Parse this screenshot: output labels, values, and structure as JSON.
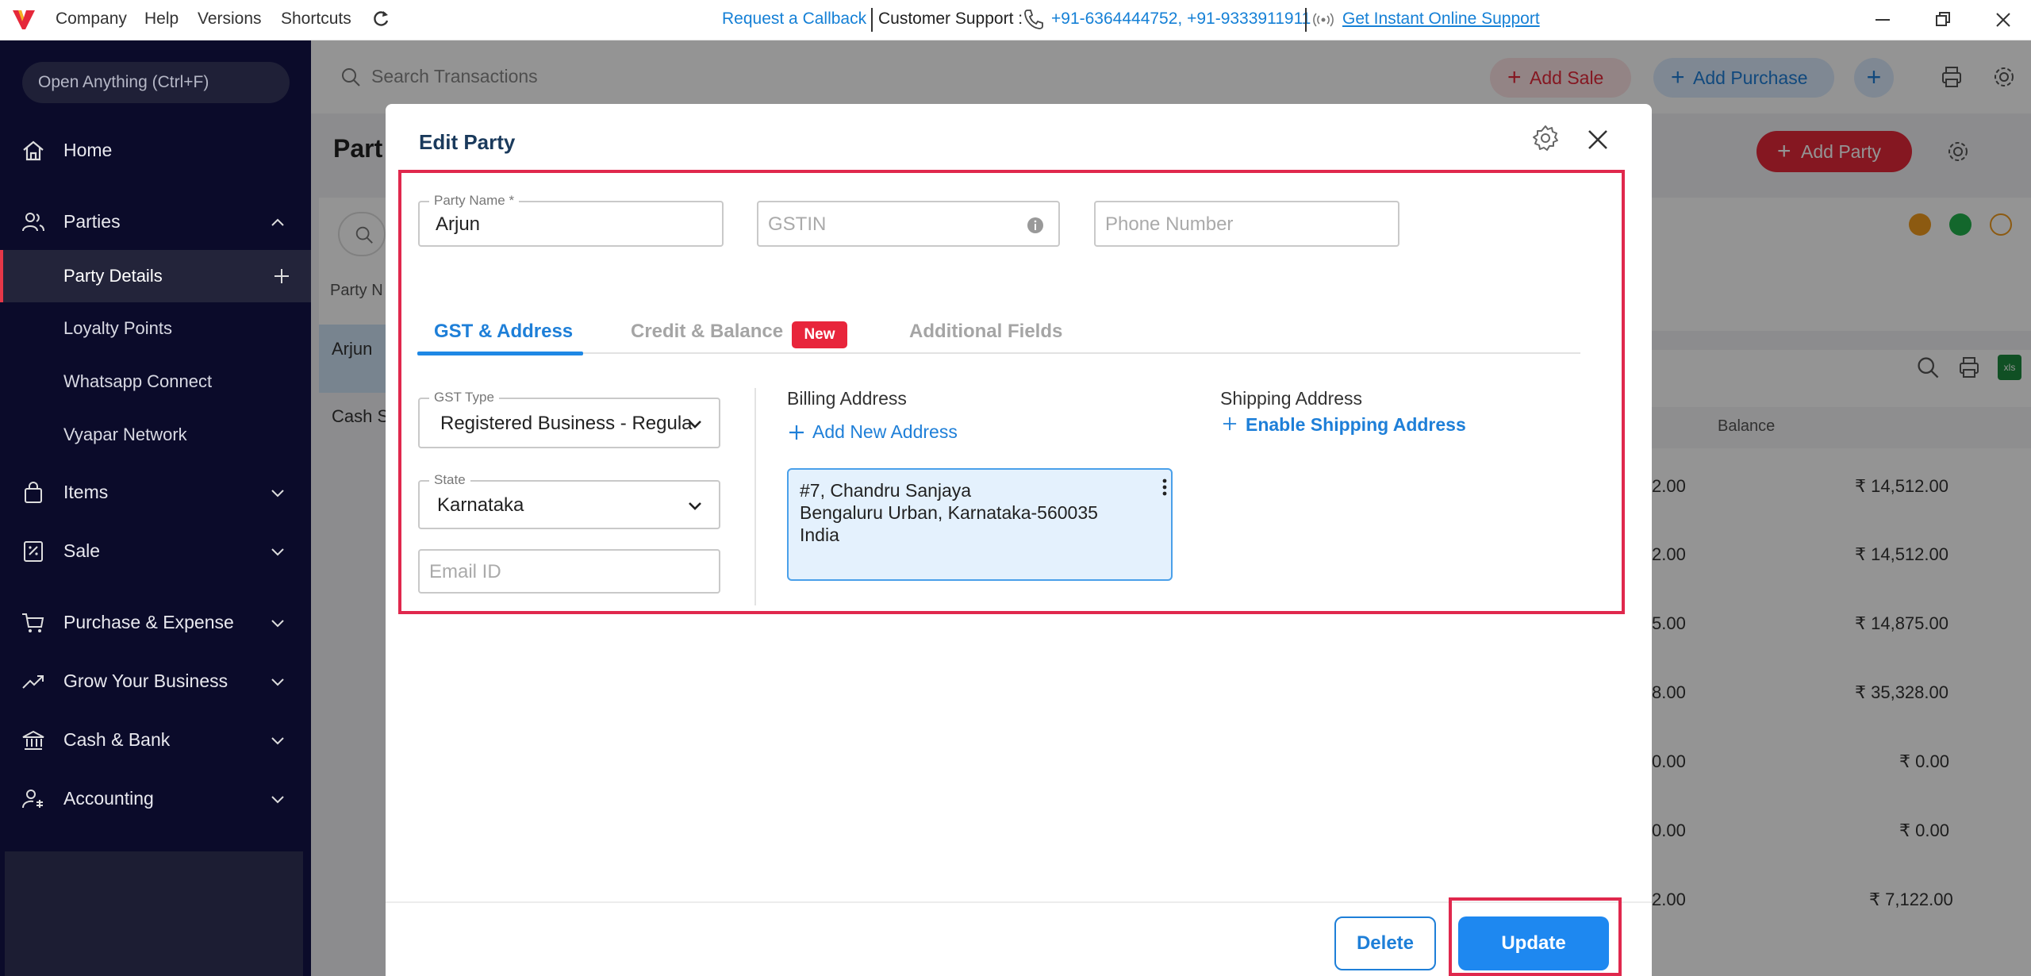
{
  "topbar": {
    "menus": [
      "Company",
      "Help",
      "Versions",
      "Shortcuts"
    ],
    "callback": "Request a Callback",
    "support_label": "Customer Support :",
    "phones": "+91-6364444752, +91-9333911911",
    "online_support": "Get Instant Online Support"
  },
  "sidebar": {
    "open_anything": "Open Anything (Ctrl+F)",
    "items": {
      "home": "Home",
      "parties": "Parties",
      "party_details": "Party Details",
      "loyalty_points": "Loyalty Points",
      "whatsapp_connect": "Whatsapp Connect",
      "vyapar_network": "Vyapar Network",
      "items": "Items",
      "sale": "Sale",
      "purchase_expense": "Purchase & Expense",
      "grow_business": "Grow Your Business",
      "cash_bank": "Cash & Bank",
      "accounting": "Accounting"
    }
  },
  "background": {
    "search_placeholder": "Search Transactions",
    "add_sale": "Add Sale",
    "add_purchase": "Add Purchase",
    "page_title": "Part",
    "add_party": "Add Party",
    "party_col": "Party N",
    "party_rows": [
      "Arjun",
      "Cash S"
    ],
    "balance_header": "Balance",
    "xls_label": "xls",
    "amount_fragments": [
      "2.00",
      "2.00",
      "5.00",
      "8.00",
      "0.00",
      "0.00",
      "2.00"
    ],
    "balances": [
      "₹ 14,512.00",
      "₹ 14,512.00",
      "₹ 14,875.00",
      "₹ 35,328.00",
      "₹ 0.00",
      "₹ 0.00",
      "₹ 7,122.00"
    ]
  },
  "modal": {
    "title": "Edit Party",
    "party_name_label": "Party Name *",
    "party_name_value": "Arjun",
    "gstin_placeholder": "GSTIN",
    "phone_placeholder": "Phone Number",
    "tabs": {
      "gst_address": "GST & Address",
      "credit_balance": "Credit & Balance",
      "new_badge": "New",
      "additional_fields": "Additional Fields"
    },
    "gst_type_label": "GST Type",
    "gst_type_value": "Registered Business - Regula",
    "state_label": "State",
    "state_value": "Karnataka",
    "email_placeholder": "Email ID",
    "billing_header": "Billing Address",
    "add_new_address": "Add New Address",
    "address_lines": [
      "#7, Chandru Sanjaya",
      "Bengaluru Urban, Karnataka-560035",
      "India"
    ],
    "shipping_header": "Shipping Address",
    "enable_shipping": "Enable Shipping Address",
    "delete_label": "Delete",
    "update_label": "Update"
  },
  "colors": {
    "accent_blue": "#1e88f0",
    "brand_red": "#e0284d",
    "sidebar_bg": "#0b0b2a"
  }
}
